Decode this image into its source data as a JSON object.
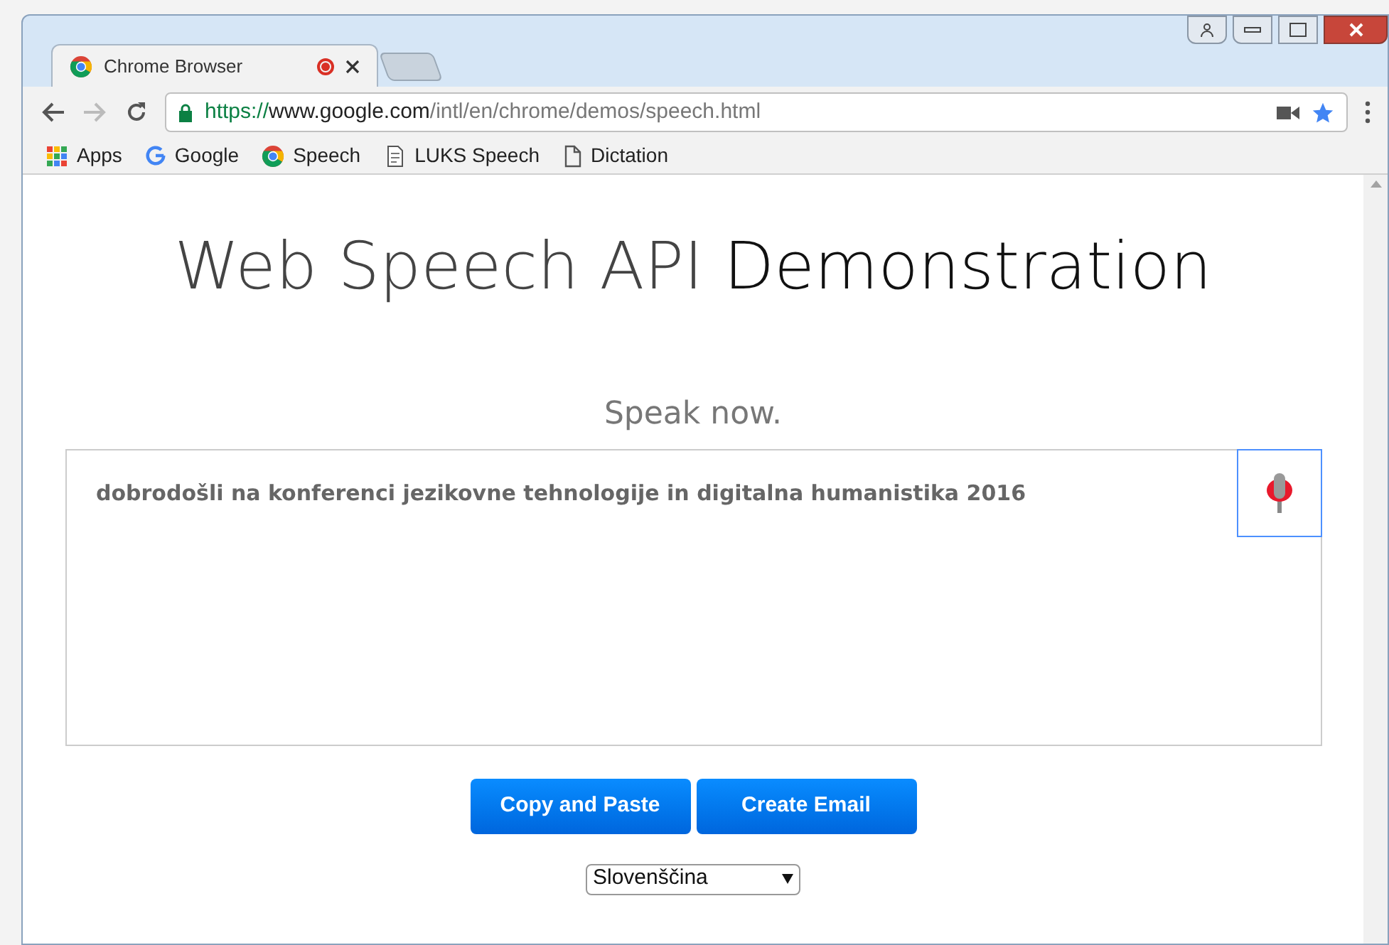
{
  "tabs": [
    {
      "title": "Chrome Browser",
      "recording": true,
      "selected": true
    }
  ],
  "address_bar": {
    "scheme": "https://",
    "host": "www.google.com",
    "path": "/intl/en/chrome/demos/speech.html"
  },
  "bookmarks": [
    {
      "kind": "apps",
      "label": "Apps"
    },
    {
      "kind": "google",
      "label": "Google"
    },
    {
      "kind": "chrome",
      "label": "Speech"
    },
    {
      "kind": "custom",
      "label": "LUKS Speech"
    },
    {
      "kind": "page",
      "label": "Dictation"
    }
  ],
  "page": {
    "title": [
      "Web Speech API",
      "Demonstration"
    ],
    "status": "Speak now.",
    "transcript": "dobrodošli na konferenci jezikovne tehnologije in digitalna humanistika 2016",
    "buttons": [
      "Copy and Paste",
      "Create Email"
    ],
    "language": "Slovenščina"
  }
}
